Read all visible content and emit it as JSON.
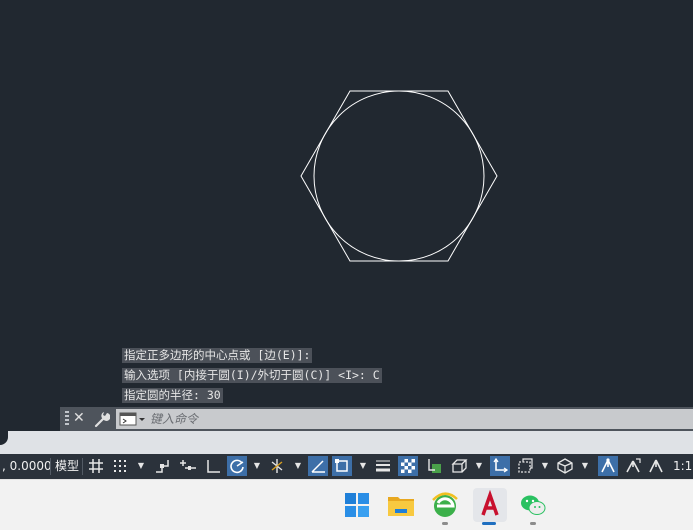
{
  "command_history": [
    "指定正多边形的中心点或 [边(E)]:",
    "输入选项 [内接于圆(I)/外切于圆(C)] <I>: C",
    "指定圆的半径: 30"
  ],
  "command_line": {
    "close_icon": "close-icon",
    "settings_icon": "wrench-icon",
    "placeholder": "键入命令",
    "value": ""
  },
  "drawing": {
    "entities": [
      "hexagon",
      "circle"
    ],
    "circle_radius": 30,
    "stroke_color": "#ffffff"
  },
  "status_bar": {
    "coordinate": ", 0.0000",
    "model_label": "模型",
    "scale_label": "1:1 /",
    "accent_color": "#3d6fa8"
  },
  "taskbar": {
    "apps": [
      "windows-start",
      "file-explorer",
      "browser",
      "autocad",
      "wechat"
    ]
  }
}
